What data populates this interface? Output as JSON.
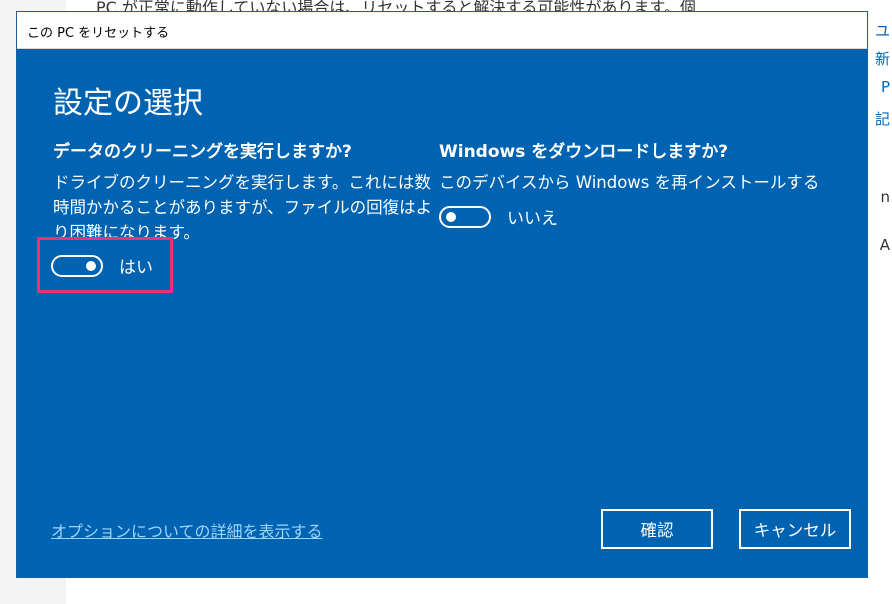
{
  "background": {
    "text": "PC が正常に動作していない場合は、リセットすると解決する可能性があります。個",
    "right_glyphs": [
      "ユ",
      "新",
      "P",
      "記",
      "n",
      "A"
    ]
  },
  "dialog": {
    "title": "この PC をリセットする",
    "heading": "設定の選択",
    "data_cleaning": {
      "question": "データのクリーニングを実行しますか?",
      "description": "ドライブのクリーニングを実行します。これには数時間かかることがありますが、ファイルの回復はより困難になります。",
      "toggle_state": "on",
      "toggle_label": "はい"
    },
    "download_windows": {
      "question": "Windows をダウンロードしますか?",
      "description": "このデバイスから Windows を再インストールする",
      "toggle_state": "off",
      "toggle_label": "いいえ"
    },
    "options_link": "オプションについての詳細を表示する",
    "confirm_label": "確認",
    "cancel_label": "キャンセル"
  },
  "colors": {
    "dialog_bg": "#0063b1",
    "highlight": "#e8327f",
    "link": "#9fd4ff"
  }
}
